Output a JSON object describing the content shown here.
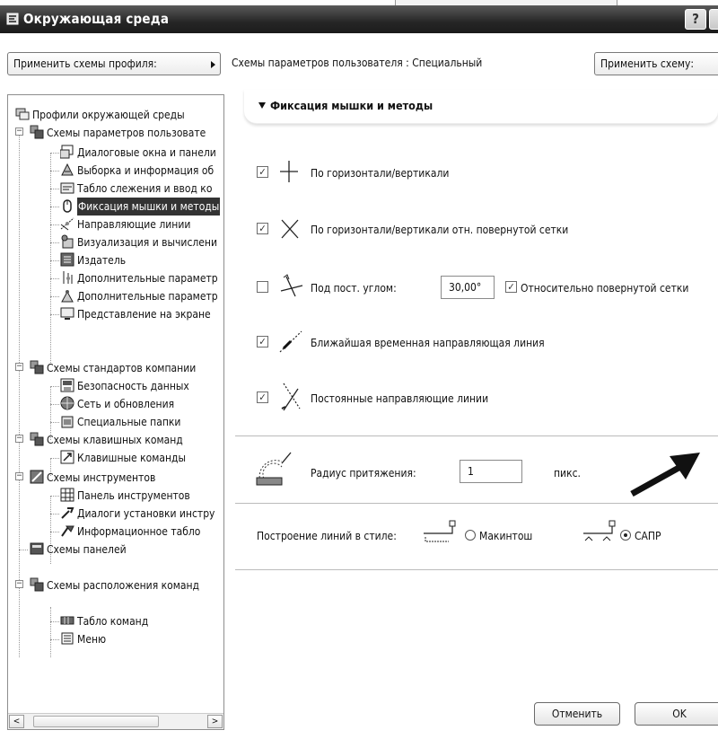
{
  "window": {
    "title": "Окружающая среда",
    "help_label": "?"
  },
  "toolbar": {
    "apply_profile": "Применить схемы профиля:",
    "schema_label": "Схемы параметров пользователя : Специальный",
    "apply_scheme": "Применить схему:"
  },
  "tree": {
    "items": [
      {
        "label": "Профили окружающей среды"
      },
      {
        "label": "Схемы параметров пользовате"
      },
      {
        "label": "Диалоговые окна и панели"
      },
      {
        "label": "Выборка и информация об"
      },
      {
        "label": "Табло слежения и ввод ко"
      },
      {
        "label": "Фиксация мышки и методы"
      },
      {
        "label": "Направляющие линии"
      },
      {
        "label": "Визуализация и вычислени"
      },
      {
        "label": "Издатель"
      },
      {
        "label": "Дополнительные параметр"
      },
      {
        "label": "Дополнительные параметр"
      },
      {
        "label": "Представление на экране"
      },
      {
        "label": "Схемы стандартов компании"
      },
      {
        "label": "Безопасность данных"
      },
      {
        "label": "Сеть и обновления"
      },
      {
        "label": "Специальные папки"
      },
      {
        "label": "Схемы клавишных команд"
      },
      {
        "label": "Клавишные команды"
      },
      {
        "label": "Схемы инструментов"
      },
      {
        "label": "Панель инструментов"
      },
      {
        "label": "Диалоги установки инстру"
      },
      {
        "label": "Информационное табло"
      },
      {
        "label": "Схемы панелей"
      },
      {
        "label": "Схемы расположения команд"
      },
      {
        "label": "Табло команд"
      },
      {
        "label": "Меню"
      }
    ],
    "selected_index": 5,
    "scroll_left": "<",
    "scroll_right": ">"
  },
  "section": {
    "title": "Фиксация мышки и методы",
    "options": [
      {
        "label": "По горизонтали/вертикали",
        "checked": true
      },
      {
        "label": "По горизонтали/вертикали отн. повернутой сетки",
        "checked": true
      },
      {
        "label": "Под пост. углом:",
        "checked": false
      },
      {
        "label": "Ближайшая временная направляющая линия",
        "checked": true
      },
      {
        "label": "Постоянные направляющие линии",
        "checked": true
      }
    ],
    "angle_value": "30,00°",
    "relative_rotated": {
      "label": "Относительно повернутой сетки",
      "checked": true
    },
    "radius_label": "Радиус притяжения:",
    "radius_value": "1",
    "radius_unit": "пикс.",
    "line_style_label": "Построение линий в стиле:",
    "style_mac": "Макинтош",
    "style_cad": "САПР",
    "selected_style": "САПР"
  },
  "buttons": {
    "cancel": "Отменить",
    "ok": "OK"
  }
}
